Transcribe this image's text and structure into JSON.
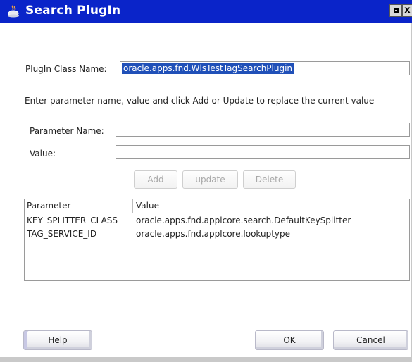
{
  "window": {
    "title": "Search PlugIn",
    "buttons": {
      "maximize_icon": "maximize-icon",
      "close_glyph": "x"
    }
  },
  "plugin_class": {
    "label": "PlugIn Class Name:",
    "value": "oracle.apps.fnd.WlsTestTagSearchPlugin"
  },
  "instructions": "Enter parameter name, value and click Add or Update to replace the current value",
  "parameter_name": {
    "label": "Parameter Name:",
    "value": ""
  },
  "value_field": {
    "label": "Value:",
    "value": ""
  },
  "actions": {
    "add": "Add",
    "update": "update",
    "delete": "Delete"
  },
  "table": {
    "headers": [
      "Parameter",
      "Value"
    ],
    "rows": [
      {
        "parameter": "KEY_SPLITTER_CLASS",
        "value": "oracle.apps.fnd.applcore.search.DefaultKeySplitter"
      },
      {
        "parameter": "TAG_SERVICE_ID",
        "value": "oracle.apps.fnd.applcore.lookuptype"
      }
    ]
  },
  "footer": {
    "help_prefix": "",
    "help_mnemonic": "H",
    "help_rest": "elp",
    "ok": "OK",
    "cancel": "Cancel"
  },
  "colors": {
    "titlebar": "#0a24c9",
    "selection": "#2050b8"
  }
}
